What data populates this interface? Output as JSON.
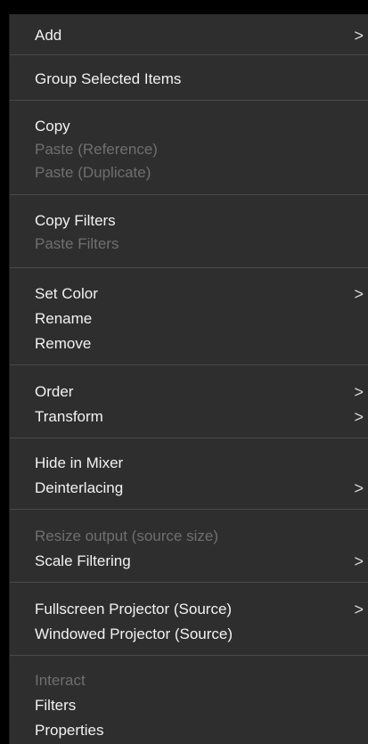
{
  "menu": {
    "add": "Add",
    "group_selected_items": "Group Selected Items",
    "copy": "Copy",
    "paste_reference": "Paste (Reference)",
    "paste_duplicate": "Paste (Duplicate)",
    "copy_filters": "Copy Filters",
    "paste_filters": "Paste Filters",
    "set_color": "Set Color",
    "rename": "Rename",
    "remove": "Remove",
    "order": "Order",
    "transform": "Transform",
    "hide_in_mixer": "Hide in Mixer",
    "deinterlacing": "Deinterlacing",
    "resize_output": "Resize output (source size)",
    "scale_filtering": "Scale Filtering",
    "fullscreen_projector": "Fullscreen Projector (Source)",
    "windowed_projector": "Windowed Projector (Source)",
    "interact": "Interact",
    "filters": "Filters",
    "properties": "Properties",
    "submenu_arrow": ">"
  },
  "colors": {
    "menu_background": "#2e2e2e",
    "text_enabled": "#f2f2f2",
    "text_disabled": "#6f6f6f",
    "separator": "#4a4a4a"
  },
  "icons": {
    "submenu": "chevron-right-icon"
  }
}
